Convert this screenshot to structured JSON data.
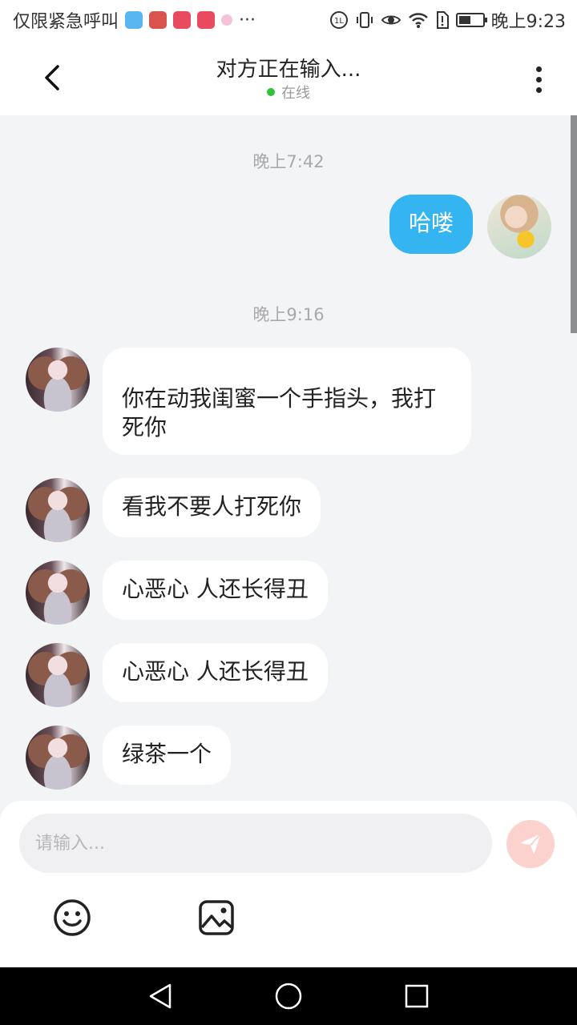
{
  "status_bar": {
    "carrier": "仅限紧急呼叫",
    "more": "···",
    "time": "晚上9:23",
    "battery_level": 0.45
  },
  "header": {
    "title": "对方正在输入...",
    "status": "在线"
  },
  "messages": [
    {
      "type": "time",
      "text": "晚上7:42"
    },
    {
      "type": "out",
      "text": "哈喽"
    },
    {
      "type": "time",
      "text": "晚上9:16"
    },
    {
      "type": "in",
      "text": "你在动我闺蜜一个手指头，我打死你"
    },
    {
      "type": "in",
      "text": "看我不要人打死你"
    },
    {
      "type": "in",
      "text": "心恶心 人还长得丑"
    },
    {
      "type": "in",
      "text": "心恶心 人还长得丑"
    },
    {
      "type": "in",
      "text": "绿茶一个"
    }
  ],
  "composer": {
    "placeholder": "请输入..."
  },
  "colors": {
    "outgoing_bubble": "#35b4f2",
    "online_dot": "#2ec43a",
    "send_button": "#fbd2cd"
  }
}
